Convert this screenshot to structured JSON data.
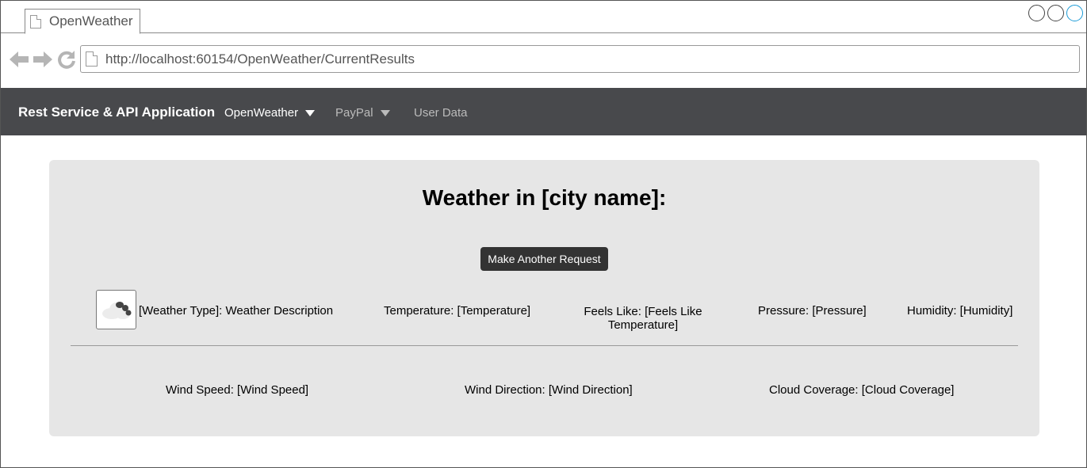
{
  "browser": {
    "tab_title": "OpenWeather",
    "url": "http://localhost:60154/OpenWeather/CurrentResults"
  },
  "navbar": {
    "brand": "Rest Service & API Application",
    "menus": [
      {
        "label": "OpenWeather",
        "dropdown": true
      },
      {
        "label": "PayPal",
        "dropdown": true
      },
      {
        "label": "User Data",
        "dropdown": false
      }
    ],
    "background_color": "#48494c"
  },
  "main": {
    "heading": "Weather in [city name]:",
    "request_button": "Make Another Request",
    "weather_icon": "cloudy-icon",
    "row1": {
      "weather_type": "[Weather Type]: Weather Description",
      "temperature": "Temperature: [Temperature]",
      "feels_like": "Feels Like: [Feels Like Temperature]",
      "pressure": "Pressure: [Pressure]",
      "humidity": "Humidity: [Humidity]"
    },
    "row2": {
      "wind_speed": "Wind Speed: [Wind Speed]",
      "wind_direction": "Wind Direction: [Wind Direction]",
      "cloud_coverage": "Cloud Coverage: [Cloud Coverage]"
    }
  }
}
